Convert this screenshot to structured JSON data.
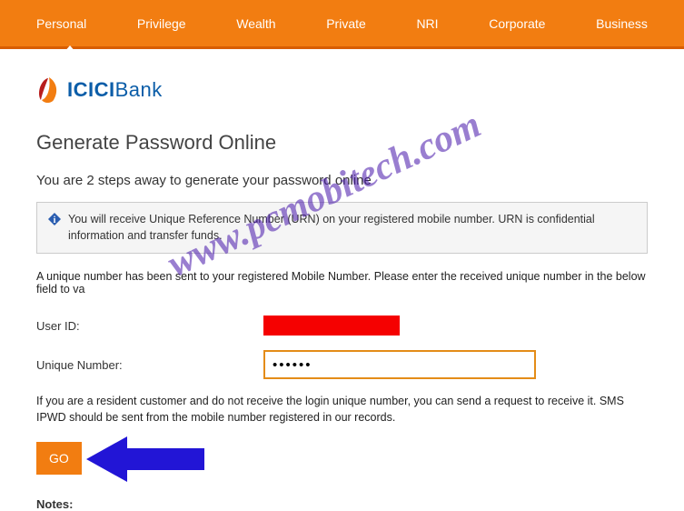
{
  "nav": {
    "items": [
      {
        "label": "Personal"
      },
      {
        "label": "Privilege"
      },
      {
        "label": "Wealth"
      },
      {
        "label": "Private"
      },
      {
        "label": "NRI"
      },
      {
        "label": "Corporate"
      },
      {
        "label": "Business"
      }
    ]
  },
  "logo": {
    "text_bold": "ICICI",
    "text_light": "Bank"
  },
  "page": {
    "title": "Generate Password Online",
    "subtitle": "You are 2 steps away to generate your password online",
    "info_text": "You will receive Unique Reference Number (URN) on your registered mobile number. URN is confidential information and transfer funds.",
    "instruction": "A unique number has been sent to your registered Mobile Number. Please enter the received unique number in the below field to va",
    "user_id_label": "User ID:",
    "unique_number_label": "Unique Number:",
    "unique_number_value": "••••••",
    "help_text": "If you are a resident customer and do not receive the login unique number, you can send a request to receive it. SMS IPWD should be sent from the mobile number registered in our records.",
    "go_label": "GO",
    "notes_label": "Notes:"
  },
  "watermark": {
    "text": "www.pcmobitech.com"
  }
}
